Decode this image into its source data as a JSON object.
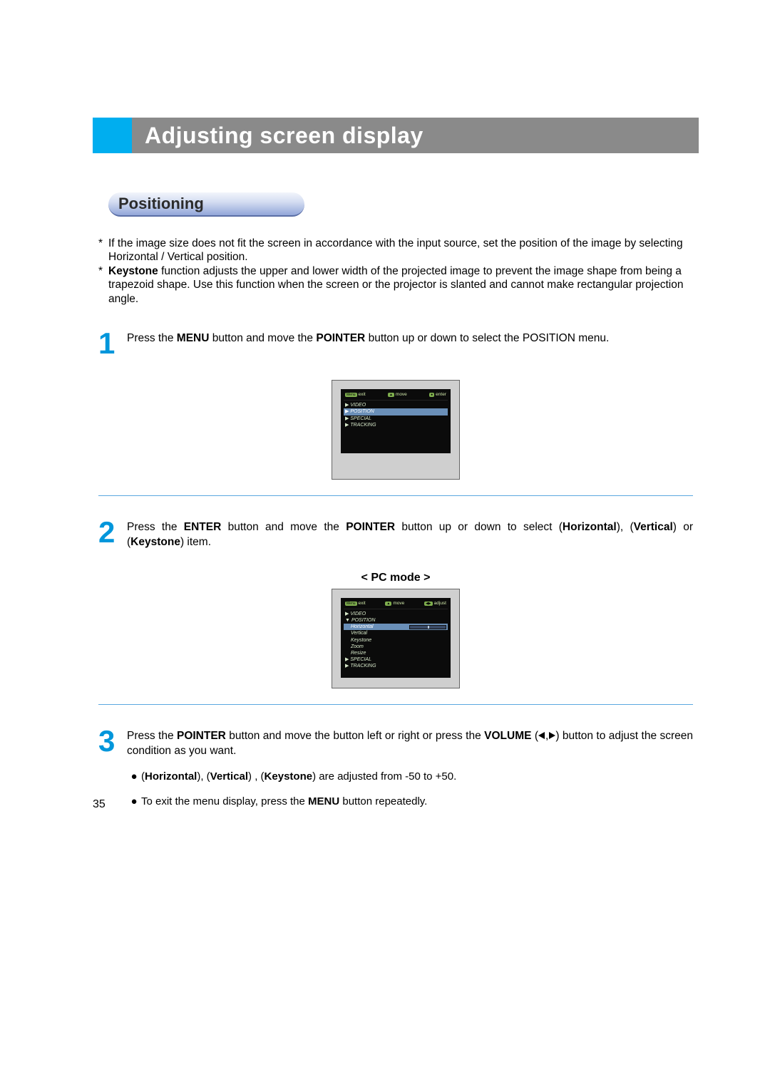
{
  "title": "Adjusting screen display",
  "section": "Positioning",
  "notes": [
    "If the image size does not fit the screen in accordance with the input source, set the position of the image by selecting Horizontal / Vertical position.",
    "Keystone function adjusts the upper and lower width of the projected image to prevent the image shape from being a trapezoid shape. Use this function when the screen or the projector is slanted and cannot make rectangular projection angle."
  ],
  "note2_bold": "Keystone",
  "steps": {
    "s1": {
      "num": "1",
      "pre": "Press the ",
      "b1": "MENU",
      "mid1": " button and move the ",
      "b2": "POINTER",
      "post": " button up or down to select the POSITION menu."
    },
    "s2": {
      "num": "2",
      "pre": "Press the ",
      "b1": "ENTER",
      "mid1": " button and move the ",
      "b2": "POINTER",
      "mid2": " button up or down to select (",
      "b3": "Horizontal",
      "mid3": "), (",
      "b4": "Vertical",
      "mid4": ") or (",
      "b5": "Keystone",
      "post": ")  item."
    },
    "s3": {
      "num": "3",
      "pre": "Press the ",
      "b1": "POINTER",
      "mid1": " button and move the button left or right or press the ",
      "b2": "VOLUME",
      "mid2": " (",
      "post": ") button to adjust the screen condition as you want."
    }
  },
  "osd_caption": "<  PC mode  >",
  "osd1": {
    "top": {
      "exit": "exit",
      "move": "move",
      "enter": "enter"
    },
    "items": [
      "VIDEO",
      "POSITION",
      "SPECIAL",
      "TRACKING"
    ],
    "hl_index": 1
  },
  "osd2": {
    "top": {
      "exit": "exit",
      "move": "move",
      "adjust": "adjust"
    },
    "items_top": [
      "VIDEO",
      "POSITION"
    ],
    "sub_hl": "Horizontal",
    "subs": [
      "Vertical",
      "Keystone",
      "Zoom",
      "Resize"
    ],
    "items_bot": [
      "SPECIAL",
      "TRACKING"
    ]
  },
  "bullets": {
    "b1_pre": "(",
    "b1_a": "Horizontal",
    "b1_m1": "), (",
    "b1_b": "Vertical",
    "b1_m2": ") , (",
    "b1_c": "Keystone",
    "b1_post": ") are adjusted from -50 to +50.",
    "b2_pre": "To exit the menu display, press the ",
    "b2_b": "MENU",
    "b2_post": " button repeatedly."
  },
  "page_number": "35"
}
